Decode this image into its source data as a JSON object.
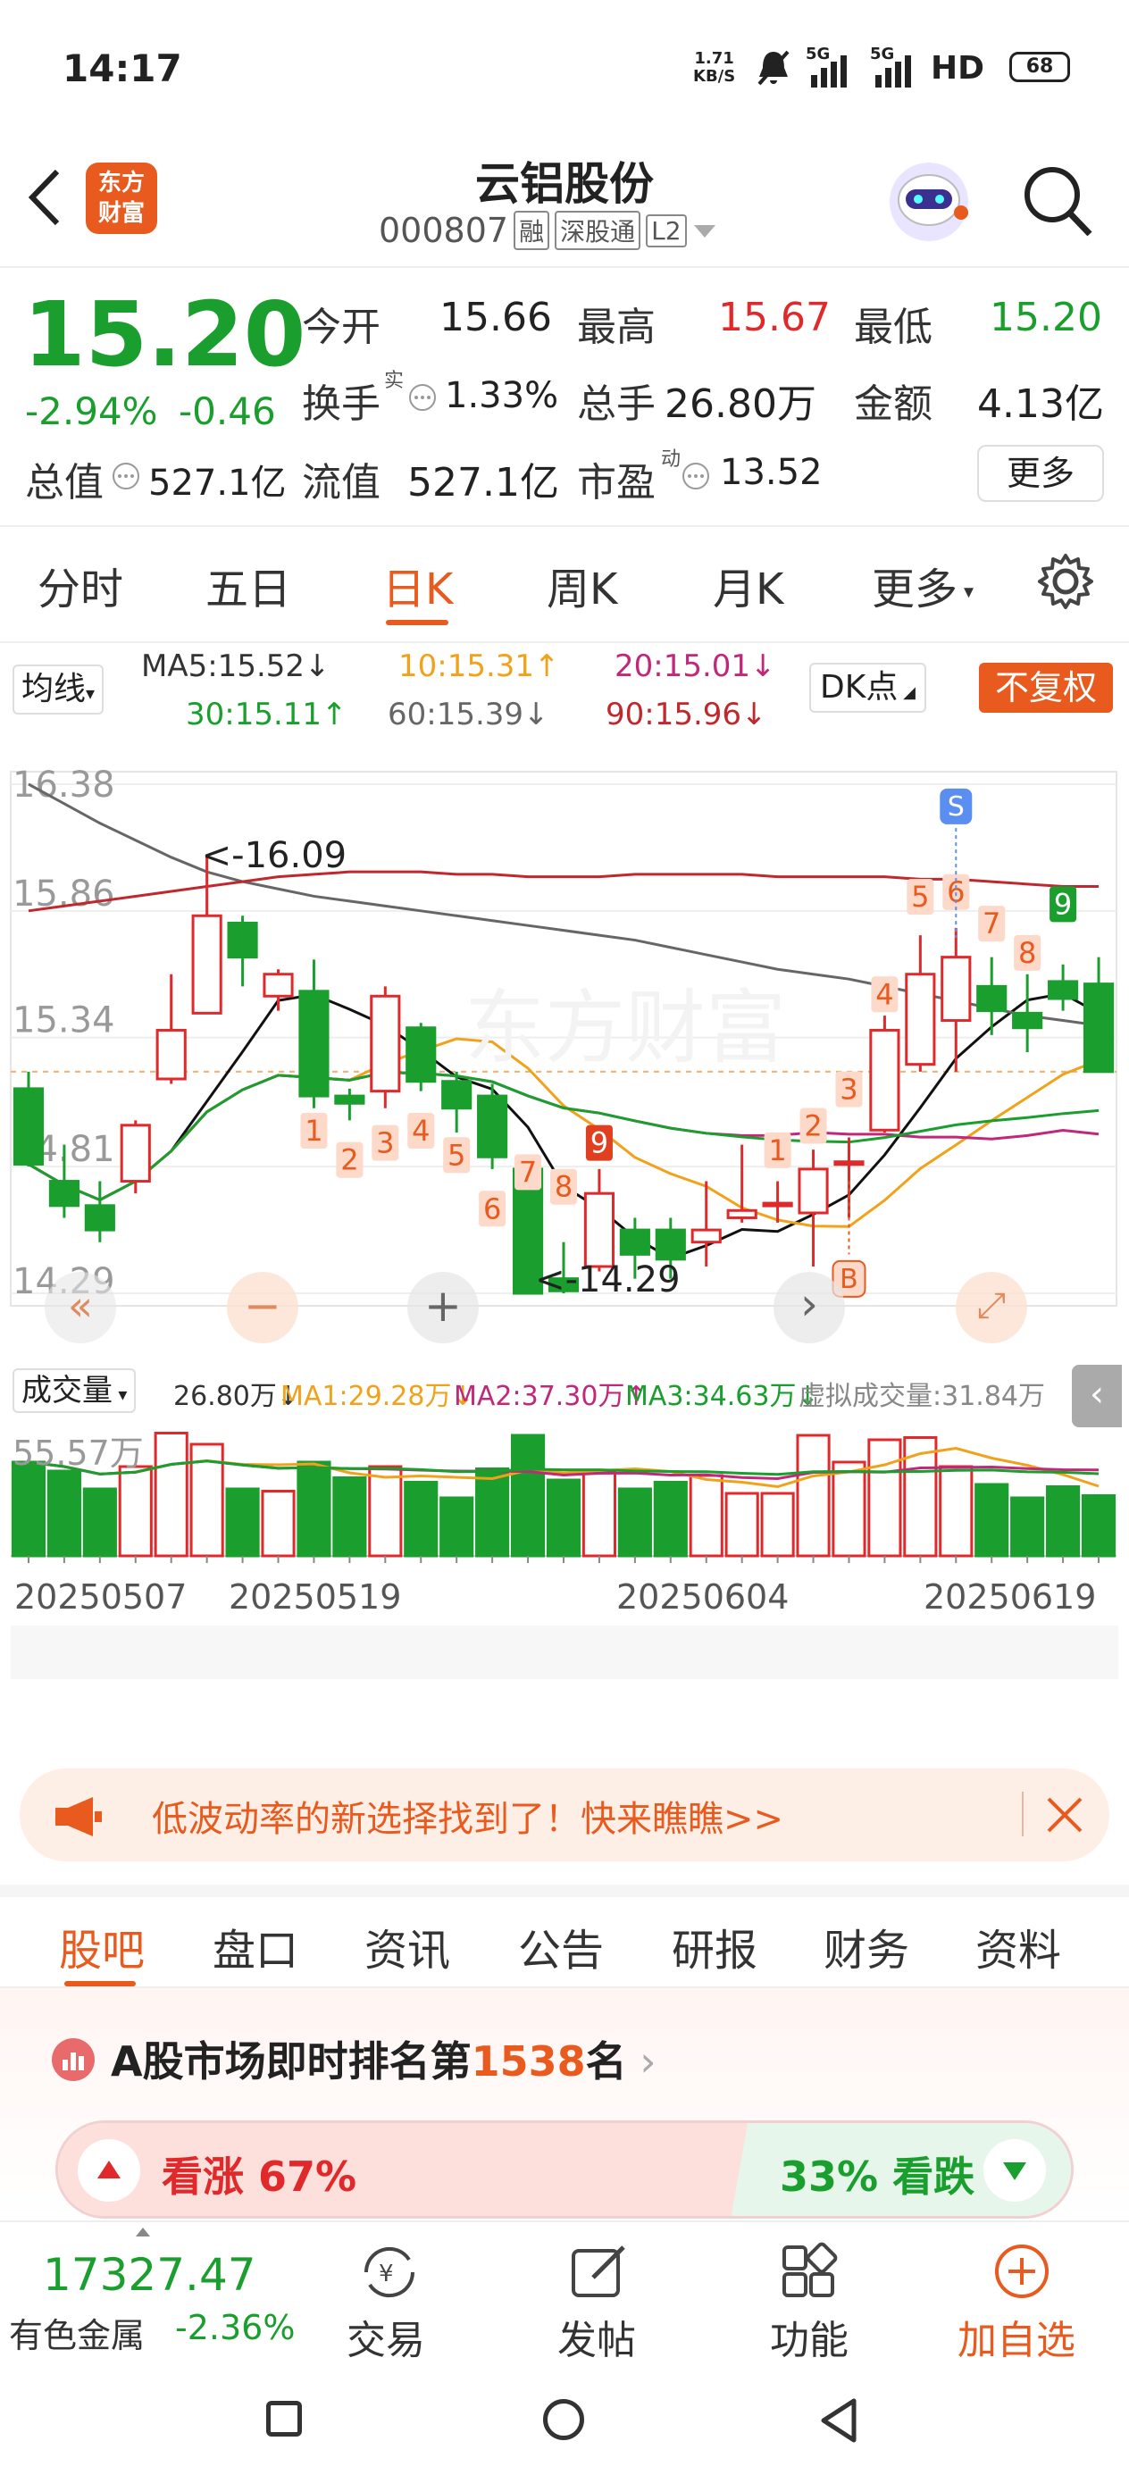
{
  "status_bar": {
    "time": "14:17",
    "net_speed_top": "1.71",
    "net_speed_bottom": "KB/S",
    "signal1": "5G",
    "signal2": "5G",
    "hd": "HD",
    "battery": "68"
  },
  "header": {
    "logo_line1": "东方",
    "logo_line2": "财富",
    "title": "云铝股份",
    "code": "000807",
    "tag_margin": "融",
    "tag_connect": "深股通",
    "tag_level": "L2"
  },
  "quote": {
    "price": "15.20",
    "change_pct": "-2.94%",
    "change": "-0.46",
    "open_label": "今开",
    "open": "15.66",
    "high_label": "最高",
    "high": "15.67",
    "low_label": "最低",
    "low": "15.20",
    "turnover_label": "换手",
    "turnover_sup": "实",
    "turnover": "1.33%",
    "volume_label": "总手",
    "volume": "26.80万",
    "amount_label": "金额",
    "amount": "4.13亿",
    "mktcap_label": "总值",
    "mktcap": "527.1亿",
    "float_label": "流值",
    "float": "527.1亿",
    "pe_label": "市盈",
    "pe_sup": "动",
    "pe": "13.52",
    "more_button": "更多"
  },
  "period_tabs": {
    "items": [
      "分时",
      "五日",
      "日K",
      "周K",
      "月K",
      "更多"
    ],
    "active_index": 2
  },
  "ma_bar": {
    "selector": "均线",
    "ma5": "MA5:15.52↓",
    "ma10": "10:15.31↑",
    "ma20": "20:15.01↓",
    "ma30": "30:15.11↑",
    "ma60": "60:15.39↓",
    "ma90": "90:15.96↓",
    "dk_button": "DK点",
    "adjust_button": "不复权"
  },
  "chart_data": {
    "type": "candlestick",
    "y_ticks": [
      "16.38",
      "15.86",
      "15.34",
      "14.81",
      "14.29"
    ],
    "ylim": [
      14.29,
      16.38
    ],
    "high_label": "<-16.09",
    "low_label": "<-14.29",
    "x_labels": [
      "20250507",
      "20250519",
      "20250604",
      "20250619"
    ],
    "candles": [
      {
        "o": 15.13,
        "c": 14.82,
        "h": 15.2,
        "l": 14.81
      },
      {
        "o": 14.75,
        "c": 14.65,
        "h": 14.9,
        "l": 14.6
      },
      {
        "o": 14.65,
        "c": 14.55,
        "h": 14.75,
        "l": 14.5
      },
      {
        "o": 14.75,
        "c": 14.98,
        "h": 15.0,
        "l": 14.7
      },
      {
        "o": 15.17,
        "c": 15.37,
        "h": 15.6,
        "l": 15.15
      },
      {
        "o": 15.44,
        "c": 15.84,
        "h": 16.09,
        "l": 15.44
      },
      {
        "o": 15.81,
        "c": 15.67,
        "h": 15.84,
        "l": 15.55
      },
      {
        "o": 15.51,
        "c": 15.6,
        "h": 15.62,
        "l": 15.45
      },
      {
        "o": 15.53,
        "c": 15.1,
        "h": 15.66,
        "l": 15.05
      },
      {
        "o": 15.1,
        "c": 15.07,
        "h": 15.13,
        "l": 15.0
      },
      {
        "o": 15.12,
        "c": 15.51,
        "h": 15.55,
        "l": 15.05
      },
      {
        "o": 15.38,
        "c": 15.16,
        "h": 15.4,
        "l": 15.12
      },
      {
        "o": 15.16,
        "c": 15.05,
        "h": 15.2,
        "l": 14.95
      },
      {
        "o": 15.1,
        "c": 14.85,
        "h": 15.15,
        "l": 14.8
      },
      {
        "o": 14.8,
        "c": 14.29,
        "h": 14.82,
        "l": 14.29
      },
      {
        "o": 14.35,
        "c": 14.3,
        "h": 14.5,
        "l": 14.29
      },
      {
        "o": 14.4,
        "c": 14.7,
        "h": 14.8,
        "l": 14.38
      },
      {
        "o": 14.55,
        "c": 14.45,
        "h": 14.6,
        "l": 14.35
      },
      {
        "o": 14.55,
        "c": 14.43,
        "h": 14.6,
        "l": 14.35
      },
      {
        "o": 14.5,
        "c": 14.55,
        "h": 14.75,
        "l": 14.4
      },
      {
        "o": 14.6,
        "c": 14.63,
        "h": 14.9,
        "l": 14.58
      },
      {
        "o": 14.66,
        "c": 14.66,
        "h": 14.75,
        "l": 14.58
      },
      {
        "o": 14.62,
        "c": 14.8,
        "h": 14.88,
        "l": 14.4
      },
      {
        "o": 14.82,
        "c": 14.83,
        "h": 14.93,
        "l": 14.6
      },
      {
        "o": 14.96,
        "c": 15.37,
        "h": 15.43,
        "l": 14.95
      },
      {
        "o": 15.23,
        "c": 15.6,
        "h": 15.76,
        "l": 15.2
      },
      {
        "o": 15.41,
        "c": 15.67,
        "h": 15.79,
        "l": 15.2
      },
      {
        "o": 15.55,
        "c": 15.45,
        "h": 15.67,
        "l": 15.35
      },
      {
        "o": 15.44,
        "c": 15.38,
        "h": 15.6,
        "l": 15.28
      },
      {
        "o": 15.57,
        "c": 15.5,
        "h": 15.64,
        "l": 15.45
      },
      {
        "o": 15.56,
        "c": 15.2,
        "h": 15.67,
        "l": 15.2
      }
    ],
    "day_markers": [
      "1",
      "2",
      "3",
      "4",
      "5",
      "6",
      "7",
      "8",
      "9",
      "1",
      "2",
      "3",
      "4",
      "5",
      "6",
      "7",
      "8",
      "9"
    ],
    "buy_marker": "B",
    "sell_marker": "S"
  },
  "chart_controls": {
    "rewind": "«",
    "zoom_out": "−",
    "zoom_in": "+",
    "next": "›",
    "fullscreen": "⤢"
  },
  "volume_bar": {
    "selector": "成交量",
    "vol": "26.80万↓",
    "ma1": "MA1:29.28万↓",
    "ma2": "MA2:37.30万↑",
    "ma3": "MA3:34.63万↓",
    "virtual": "虚拟成交量:31.84万",
    "max_label": "55.57万"
  },
  "volume_data": [
    42,
    38,
    30,
    40,
    55,
    50,
    30,
    29,
    42,
    35,
    40,
    33,
    26,
    39,
    54,
    34,
    38,
    30,
    33,
    36,
    28,
    28,
    54,
    42,
    52,
    53,
    40,
    32,
    26,
    31,
    27
  ],
  "banner": {
    "text": "低波动率的新选择找到了！快来瞧瞧>>"
  },
  "bottom_tabs": {
    "items": [
      "股吧",
      "盘口",
      "资讯",
      "公告",
      "研报",
      "财务",
      "资料"
    ],
    "active_index": 0
  },
  "ranking": {
    "prefix": "A股市场即时排名第",
    "rank": "1538",
    "suffix": "名",
    "bull_label": "看涨 67%",
    "bear_label": "33% 看跌"
  },
  "bottom_bar": {
    "index_value": "17327.47",
    "index_name": "有色金属",
    "index_change": "-2.36%",
    "trade": "交易",
    "post": "发帖",
    "functions": "功能",
    "add_watch": "加自选"
  }
}
